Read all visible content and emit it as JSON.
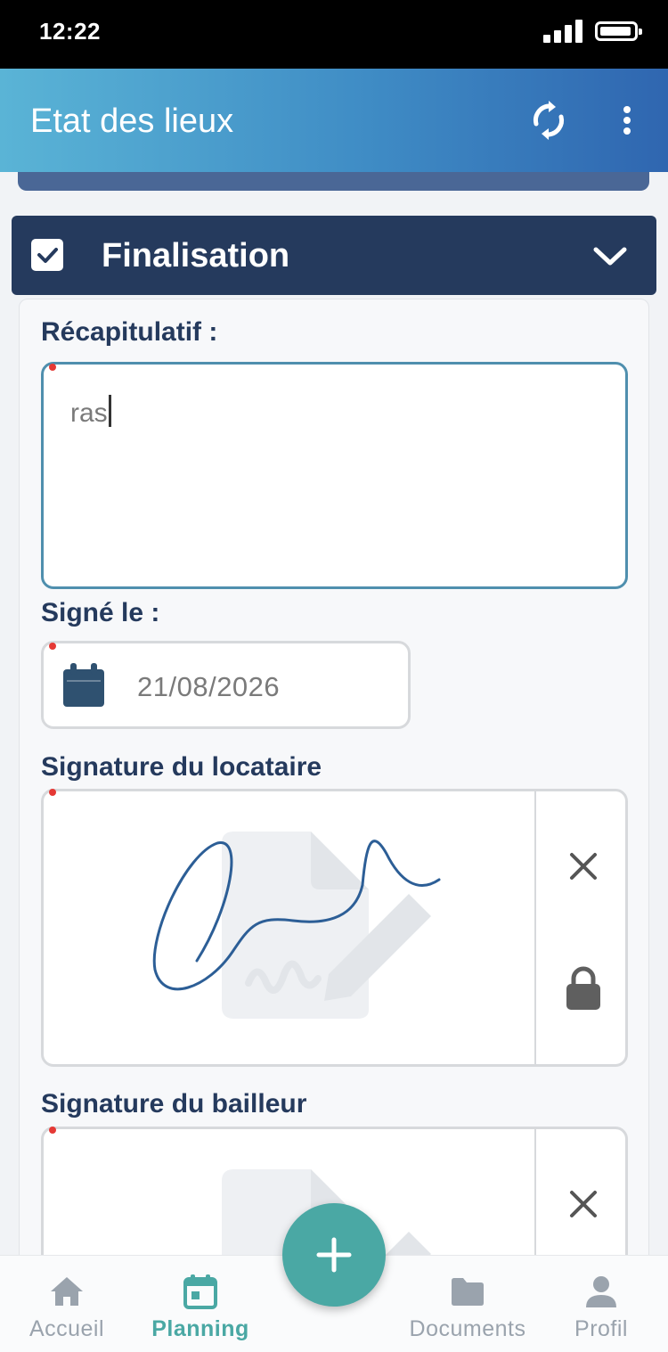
{
  "status_bar": {
    "time": "12:22"
  },
  "app_bar": {
    "title": "Etat des lieux",
    "sync_icon": "sync-icon",
    "menu_icon": "more-vertical-icon"
  },
  "section": {
    "title": "Finalisation",
    "checked": true
  },
  "form": {
    "recap": {
      "label": "Récapitulatif :",
      "value": "ras"
    },
    "signed_on": {
      "label": "Signé le :",
      "value": "21/08/2026",
      "icon": "calendar-icon"
    },
    "tenant_signature": {
      "label": "Signature du locataire",
      "clear_icon": "close-icon",
      "lock_icon": "lock-icon",
      "signed": true
    },
    "landlord_signature": {
      "label": "Signature du bailleur",
      "clear_icon": "close-icon",
      "signed": false
    }
  },
  "bottom_nav": {
    "items": [
      {
        "label": "Accueil",
        "icon": "home-icon",
        "active": false
      },
      {
        "label": "Planning",
        "icon": "calendar-icon",
        "active": true
      },
      {
        "label": "Documents",
        "icon": "folder-icon",
        "active": false
      },
      {
        "label": "Profil",
        "icon": "person-icon",
        "active": false
      }
    ],
    "fab_icon": "plus-icon"
  },
  "colors": {
    "header_dark": "#253a5d",
    "accent_teal": "#4aa8a4",
    "required_dot": "#e53935",
    "signature_stroke": "#2c5e96"
  }
}
